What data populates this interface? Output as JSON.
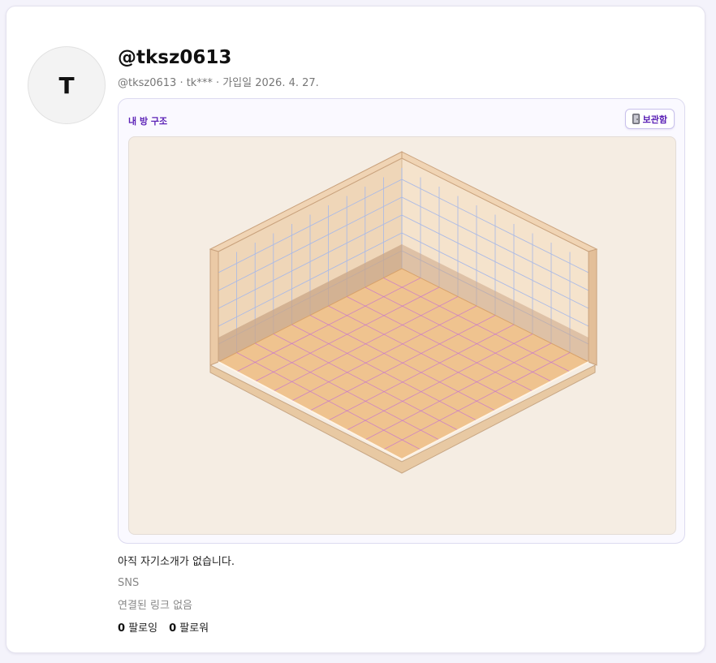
{
  "profile": {
    "avatar_initial": "T",
    "display_name": "@tksz0613",
    "meta": "@tksz0613 · tk*** · 가입일 2026. 4. 27.",
    "bio": "아직 자기소개가 없습니다."
  },
  "room": {
    "title": "내 방 구조",
    "storage_label": "보관함",
    "storage_icon": "door-icon",
    "colors": {
      "background": "#f5ede3",
      "floor": "#efc38f",
      "floor_grid": "#c46fd2",
      "wall_left": "#efd6b8",
      "wall_right": "#f5e3cc",
      "wall_grid": "#a8b9e8",
      "baseboard": "#caa687",
      "trim": "#f0d4b4"
    }
  },
  "sns": {
    "heading": "SNS",
    "empty_text": "연결된 링크 없음"
  },
  "follow": {
    "following_count": "0",
    "following_label": "팔로잉",
    "followers_count": "0",
    "followers_label": "팔로워"
  }
}
